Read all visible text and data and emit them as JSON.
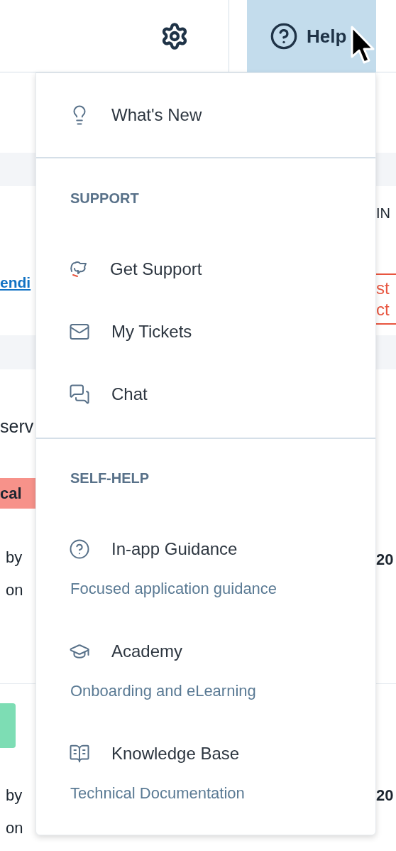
{
  "header": {
    "help_button": {
      "label": "Help",
      "expanded": true
    }
  },
  "background": {
    "upper_row": {
      "link": "endi",
      "right_label": "IN",
      "status_lines": [
        "st",
        "ct"
      ]
    },
    "card": {
      "title": "serv",
      "badge": "cal",
      "meta_lines": [
        "by",
        "on"
      ],
      "right_value": "20"
    },
    "next_card": {
      "meta_lines": [
        "by",
        "on"
      ],
      "right_value": "20"
    }
  },
  "help_menu": {
    "top_item": {
      "label": "What's New"
    },
    "sections": [
      {
        "heading": "SUPPORT",
        "items": [
          {
            "label": "Get Support"
          },
          {
            "label": "My Tickets"
          },
          {
            "label": "Chat"
          }
        ]
      },
      {
        "heading": "SELF-HELP",
        "items": [
          {
            "label": "In-app Guidance",
            "description": "Focused application guidance"
          },
          {
            "label": "Academy",
            "description": "Onboarding and eLearning"
          },
          {
            "label": "Knowledge Base",
            "description": "Technical Documentation"
          }
        ]
      }
    ]
  }
}
